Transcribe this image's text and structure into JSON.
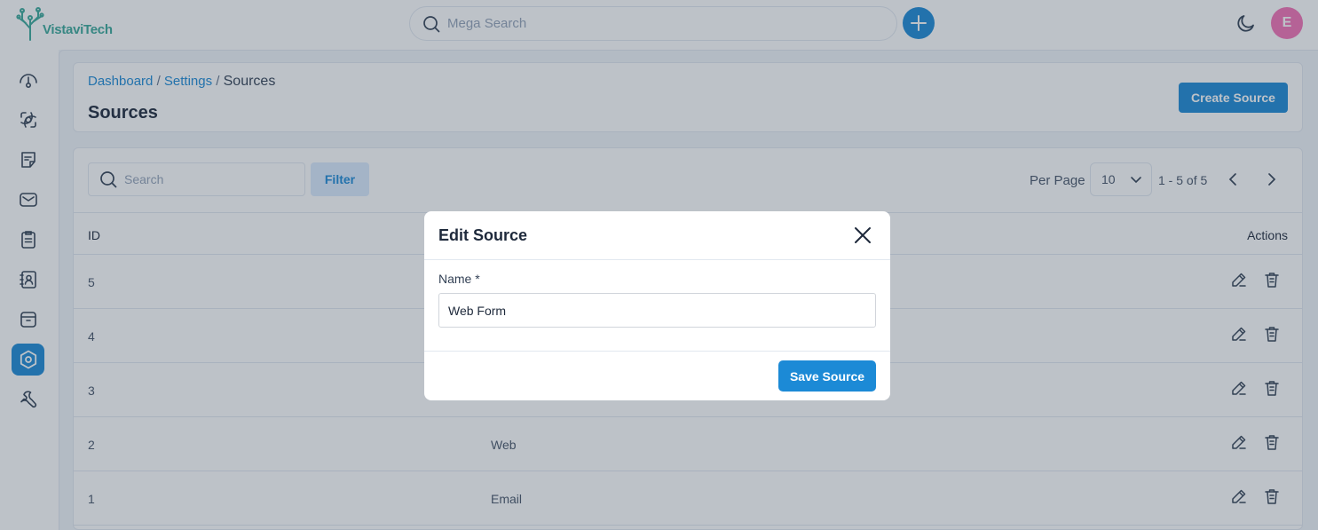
{
  "app": {
    "logo_text": "VistaviTech"
  },
  "topbar": {
    "search_placeholder": "Mega Search",
    "avatar_initial": "E",
    "icons": [
      "search-icon",
      "plus-icon",
      "moon-icon"
    ]
  },
  "sidebar": {
    "items": [
      {
        "icon": "dashboard-gauge-icon",
        "active": false
      },
      {
        "icon": "integration-icon",
        "active": false
      },
      {
        "icon": "note-icon",
        "active": false
      },
      {
        "icon": "mail-icon",
        "active": false
      },
      {
        "icon": "clipboard-icon",
        "active": false
      },
      {
        "icon": "contacts-icon",
        "active": false
      },
      {
        "icon": "archive-icon",
        "active": false
      },
      {
        "icon": "settings-icon",
        "active": true
      },
      {
        "icon": "wrench-icon",
        "active": false
      }
    ]
  },
  "breadcrumb": {
    "items": [
      "Dashboard",
      "Settings"
    ],
    "current": "Sources",
    "separator": "/"
  },
  "page": {
    "title": "Sources",
    "create_label": "Create Source"
  },
  "toolbar": {
    "search_placeholder": "Search",
    "filter_label": "Filter",
    "per_page_label": "Per Page",
    "per_page_value": "10",
    "range_text": "1 - 5 of 5"
  },
  "table": {
    "columns": {
      "id": "ID",
      "name": "",
      "actions": "Actions"
    },
    "rows": [
      {
        "id": "5",
        "name": ""
      },
      {
        "id": "4",
        "name": ""
      },
      {
        "id": "3",
        "name": ""
      },
      {
        "id": "2",
        "name": "Web"
      },
      {
        "id": "1",
        "name": "Email"
      }
    ]
  },
  "modal": {
    "title": "Edit Source",
    "name_label": "Name *",
    "name_value": "Web Form",
    "save_label": "Save Source"
  },
  "colors": {
    "primary": "#1c8ad6",
    "avatar": "#f472b6",
    "logo": "#3aa89a"
  }
}
